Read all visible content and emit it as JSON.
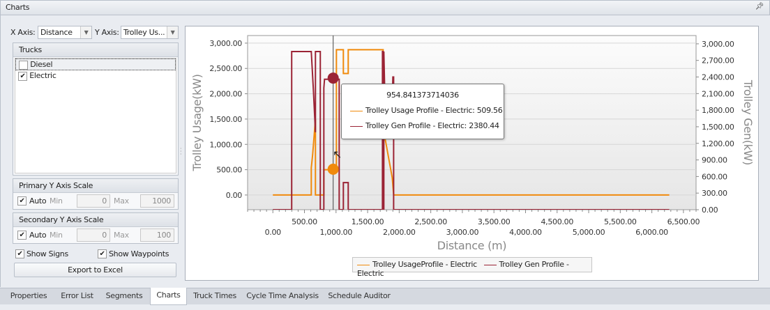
{
  "window": {
    "title": "Charts",
    "pin_icon": "pin-icon"
  },
  "controls": {
    "x_axis_label": "X Axis:",
    "x_axis_value": "Distance",
    "y_axis_label": "Y Axis:",
    "y_axis_value": "Trolley Us..."
  },
  "trucks": {
    "title": "Trucks",
    "items": [
      {
        "label": "Diesel",
        "checked": false
      },
      {
        "label": "Electric",
        "checked": true
      }
    ]
  },
  "primary_scale": {
    "title": "Primary Y Axis Scale",
    "auto_label": "Auto",
    "auto": true,
    "min_label": "Min",
    "min": "0",
    "max_label": "Max",
    "max": "1000"
  },
  "secondary_scale": {
    "title": "Secondary Y Axis Scale",
    "auto_label": "Auto",
    "auto": true,
    "min_label": "Min",
    "min": "0",
    "max_label": "Max",
    "max": "100"
  },
  "options": {
    "show_signs": "Show Signs",
    "show_waypoints": "Show Waypoints"
  },
  "export_label": "Export to Excel",
  "tabs": [
    "Properties",
    "Error List",
    "Segments",
    "Charts",
    "Truck Times",
    "Cycle Time Analysis",
    "Schedule Auditor"
  ],
  "active_tab": "Charts",
  "tooltip": {
    "title": "954.841373714036",
    "rows": [
      "Trolley Usage Profile - Electric: 509.56",
      "Trolley Gen Profile - Electric: 2380.44"
    ]
  },
  "colors": {
    "usage": "#f08a0c",
    "gen": "#9b2335",
    "crosshair": "#c040c0"
  },
  "chart_data": {
    "type": "line",
    "xlabel": "Distance (m)",
    "ylabel": "Trolley Usage(kW)",
    "y2label": "Trolley Gen(kW)",
    "xlim": [
      -400,
      6700
    ],
    "ylim": [
      -290,
      3150
    ],
    "y2lim": [
      0,
      3150
    ],
    "x_ticks": [
      0,
      500,
      1000,
      1500,
      2000,
      2500,
      3000,
      3500,
      4000,
      4500,
      5000,
      5500,
      6000,
      6500
    ],
    "x_tick_labels": [
      "0.00",
      "500.00",
      "1,000.00",
      "1,500.00",
      "2,000.00",
      "2,500.00",
      "3,000.00",
      "3,500.00",
      "4,000.00",
      "4,500.00",
      "5,000.00",
      "5,500.00",
      "6,000.00",
      "6,500.00"
    ],
    "y_ticks": [
      0,
      500,
      1000,
      1500,
      2000,
      2500,
      3000
    ],
    "y_tick_labels": [
      "0.00",
      "500.00",
      "1,000.00",
      "1,500.00",
      "2,000.00",
      "2,500.00",
      "3,000.00"
    ],
    "y2_ticks": [
      0,
      300,
      600,
      900,
      1200,
      1500,
      1800,
      2100,
      2400,
      2700,
      3000
    ],
    "y2_tick_labels": [
      "0.00",
      "300.00",
      "600.00",
      "900.00",
      "1,200.00",
      "1,500.00",
      "1,800.00",
      "2,100.00",
      "2,400.00",
      "2,700.00",
      "3,000.00"
    ],
    "crosshair_x": 954.84,
    "series": [
      {
        "name": "Trolley UsageProfile - Electric",
        "axis": "primary",
        "color": "#f08a0c",
        "marker": 509.56,
        "points": [
          [
            0,
            0
          ],
          [
            608,
            0
          ],
          [
            608,
            536
          ],
          [
            630,
            800
          ],
          [
            674,
            1500
          ],
          [
            674,
            0
          ],
          [
            807,
            0
          ],
          [
            807,
            500
          ],
          [
            1006,
            500
          ],
          [
            1006,
            2870
          ],
          [
            1116,
            2870
          ],
          [
            1116,
            2400
          ],
          [
            1193,
            2400
          ],
          [
            1193,
            2870
          ],
          [
            1746,
            2870
          ],
          [
            1746,
            1220
          ],
          [
            1779,
            1100
          ],
          [
            1890,
            340
          ],
          [
            1912,
            0
          ],
          [
            6276,
            0
          ]
        ]
      },
      {
        "name": "Trolley Gen Profile - Electric",
        "axis": "secondary",
        "color": "#9b2335",
        "marker": 2380.44,
        "points": [
          [
            0,
            0
          ],
          [
            298,
            0
          ],
          [
            298,
            2860
          ],
          [
            608,
            2860
          ],
          [
            640,
            2200
          ],
          [
            674,
            1400
          ],
          [
            674,
            2860
          ],
          [
            751,
            2860
          ],
          [
            751,
            0
          ],
          [
            807,
            0
          ],
          [
            807,
            2200
          ],
          [
            818,
            2360
          ],
          [
            1050,
            2360
          ],
          [
            1050,
            0
          ],
          [
            1116,
            0
          ],
          [
            1116,
            490
          ],
          [
            1193,
            490
          ],
          [
            1193,
            0
          ],
          [
            1735,
            0
          ],
          [
            1735,
            2860
          ],
          [
            1746,
            2860
          ],
          [
            1746,
            0
          ],
          [
            1757,
            0
          ],
          [
            1757,
            2860
          ],
          [
            1770,
            2200
          ],
          [
            1890,
            1950
          ],
          [
            1900,
            2400
          ],
          [
            1912,
            2400
          ],
          [
            1912,
            0
          ],
          [
            6276,
            0
          ]
        ]
      }
    ]
  }
}
